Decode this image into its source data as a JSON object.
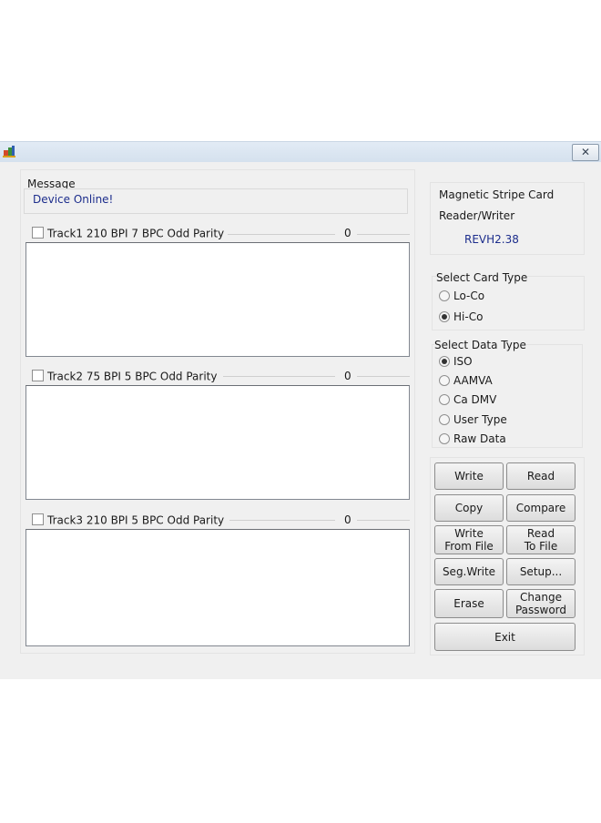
{
  "window": {
    "close_glyph": "✕"
  },
  "message": {
    "label": "Message",
    "value": "Device Online!"
  },
  "tracks": [
    {
      "label": "Track1  210 BPI  7 BPC  Odd Parity",
      "count": "0"
    },
    {
      "label": "Track2  75 BPI  5 BPC  Odd Parity",
      "count": "0"
    },
    {
      "label": "Track3  210 BPI  5 BPC  Odd Parity",
      "count": "0"
    }
  ],
  "device": {
    "line1": "Magnetic Stripe Card",
    "line2": "Reader/Writer",
    "version": "REVH2.38"
  },
  "card_type": {
    "label": "Select Card Type",
    "options": [
      "Lo-Co",
      "Hi-Co"
    ],
    "selected": "Hi-Co"
  },
  "data_type": {
    "label": "Select Data Type",
    "options": [
      "ISO",
      "AAMVA",
      "Ca DMV",
      "User Type",
      "Raw Data"
    ],
    "selected": "ISO"
  },
  "buttons": {
    "write": "Write",
    "read": "Read",
    "copy": "Copy",
    "compare": "Compare",
    "write_from_file": "Write\nFrom File",
    "read_to_file": "Read\nTo File",
    "seg_write": "Seg.Write",
    "setup": "Setup...",
    "erase": "Erase",
    "change_password": "Change\nPassword",
    "exit": "Exit"
  }
}
